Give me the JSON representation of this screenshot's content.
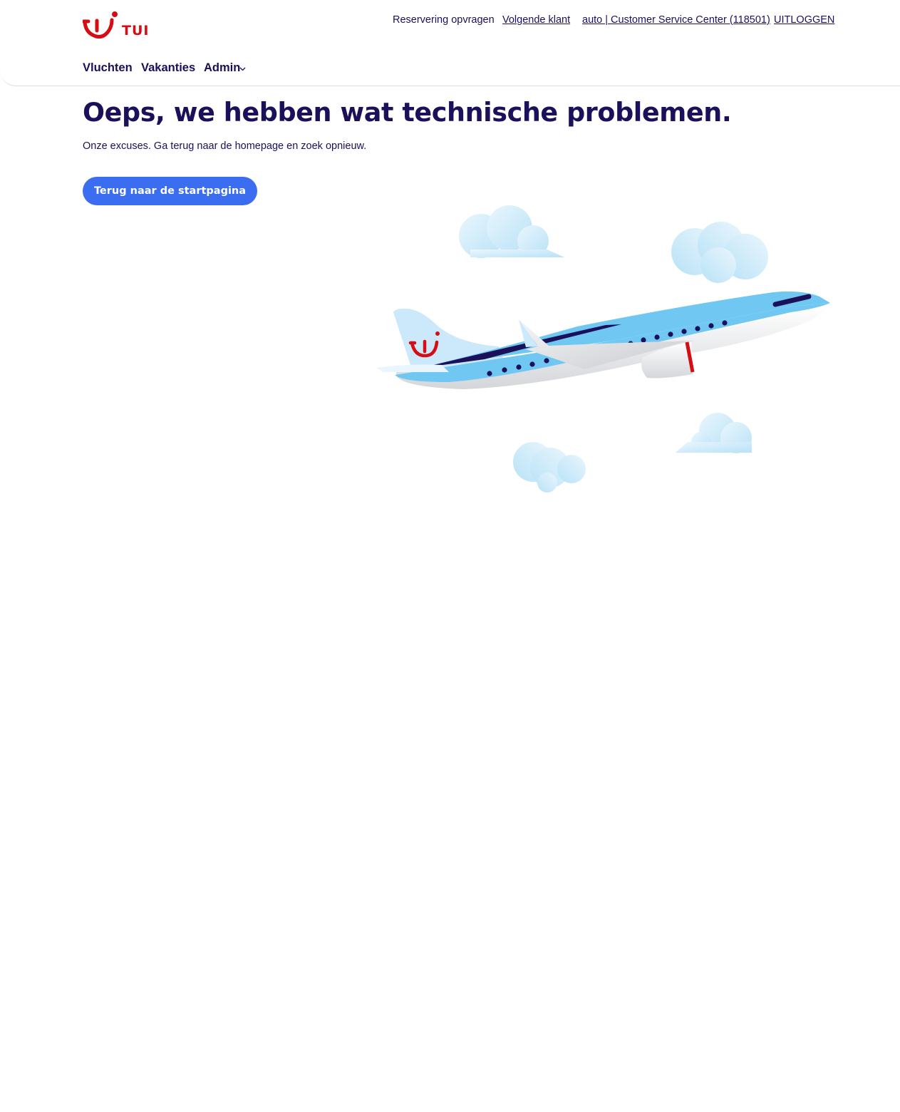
{
  "brand": {
    "name": "TUI",
    "icon": "tui-smile-logo-icon",
    "color": "#d40e14"
  },
  "top_links": {
    "booking_lookup": "Reservering opvragen",
    "next_customer": "Volgende klant",
    "agent": "auto | Customer Service Center (118501)",
    "logout": "UITLOGGEN"
  },
  "nav": {
    "flights": "Vluchten",
    "holidays": "Vakanties",
    "admin": "Admin",
    "admin_icon": "chevron-down-icon"
  },
  "error": {
    "title": "Oeps, we hebben wat technische problemen.",
    "message": "Onze excuses. Ga terug naar de homepage en zoek opnieuw.",
    "button": "Terug naar de startpagina"
  },
  "illustration": {
    "subject": "airplane-with-clouds",
    "tail_logo_icon": "tui-smile-icon"
  },
  "colors": {
    "navy": "#1a115a",
    "button_blue": "#3a6df0",
    "sky_blue": "#70c8f2",
    "red": "#d40e14"
  }
}
